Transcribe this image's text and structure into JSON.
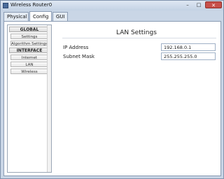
{
  "window": {
    "title": "Wireless Router0",
    "minimize_icon": "minimize-icon",
    "maximize_icon": "maximize-icon",
    "close_icon": "close-icon",
    "minimize_glyph": "–",
    "maximize_glyph": "□",
    "close_glyph": "✕"
  },
  "tabs": [
    {
      "label": "Physical"
    },
    {
      "label": "Config"
    },
    {
      "label": "GUI"
    }
  ],
  "sidebar": {
    "global_header": "GLOBAL",
    "global_items": [
      "Settings",
      "Algorithm Settings"
    ],
    "interface_header": "INTERFACE",
    "interface_items": [
      "Internet",
      "LAN",
      "Wireless"
    ]
  },
  "panel": {
    "title": "LAN Settings",
    "ip_label": "IP Address",
    "ip_value": "192.168.0.1",
    "mask_label": "Subnet Mask",
    "mask_value": "255.255.255.0"
  },
  "colors": {
    "accent": "#4a6c9b",
    "close": "#c7504a"
  }
}
